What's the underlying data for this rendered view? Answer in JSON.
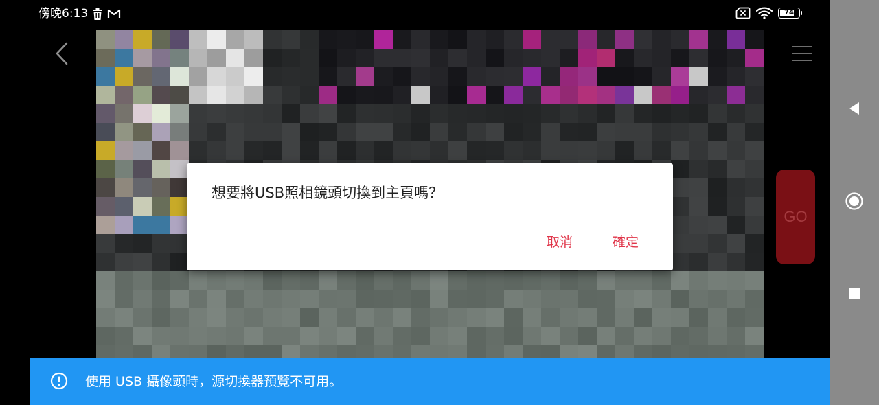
{
  "status_bar": {
    "time": "傍晚6:13",
    "left_icons": [
      "trash-icon",
      "gmail-icon"
    ],
    "right_icons": [
      "sim-off-icon",
      "wifi-icon",
      "battery-icon"
    ],
    "battery_level": "74"
  },
  "toolbar": {
    "back_icon": "chevron-left-icon",
    "menu_icon": "hamburger-menu-icon"
  },
  "go_button": {
    "label": "GO"
  },
  "dialog": {
    "message": "想要將USB照相鏡頭切換到主頁嗎？",
    "cancel_label": "取消",
    "confirm_label": "確定"
  },
  "info_banner": {
    "icon": "info-circle-icon",
    "text": "使用 USB 攝像頭時，源切換器預覽不可用。"
  },
  "nav_bar": {
    "buttons": [
      "nav-back-icon",
      "nav-home-icon",
      "nav-recents-icon"
    ]
  },
  "colors": {
    "accent_red": "#e0364a",
    "banner_blue": "#2196f3",
    "go_button_bg": "#7a1015",
    "nav_bar_bg": "#8a8a8a"
  }
}
